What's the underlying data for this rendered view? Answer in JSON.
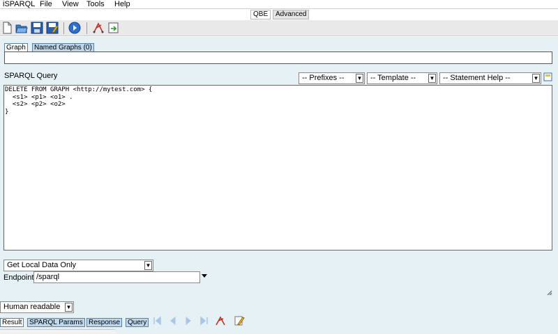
{
  "menu": {
    "app": "iSPARQL",
    "items": [
      "File",
      "View",
      "Tools",
      "Help"
    ]
  },
  "mode_tabs": {
    "qbe": "QBE",
    "advanced": "Advanced"
  },
  "toolbar": {
    "icons": [
      "new-document-icon",
      "open-folder-icon",
      "save-icon",
      "save-as-icon",
      "run-query-icon",
      "graph-view-icon",
      "load-icon"
    ]
  },
  "graph_tabs": {
    "graph": "Graph",
    "named_graphs": "Named Graphs (0)"
  },
  "query": {
    "label": "SPARQL Query",
    "prefixes": "-- Prefixes --",
    "template": "-- Template --",
    "statement_help": "-- Statement Help --",
    "text": "DELETE FROM GRAPH <http://mytest.com> {\n  <s1> <p1> <o1> .\n  <s2> <p2> <o2>\n}"
  },
  "retrieval": {
    "selected": "Get Local Data Only"
  },
  "endpoint": {
    "label": "Endpoint",
    "value": "/sparql"
  },
  "format": {
    "selected": "Human readable"
  },
  "result_tabs": {
    "result": "Result",
    "params": "SPARQL Params",
    "response": "Response",
    "query": "Query"
  },
  "colors": {
    "panel_bg": "#e6f1f5",
    "tab_inactive": "#bfd7ea",
    "toolbar_bg": "#e9e9e9"
  }
}
